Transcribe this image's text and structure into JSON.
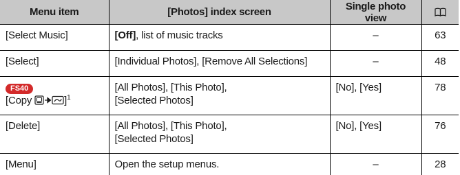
{
  "header": {
    "col_menu": "Menu item",
    "col_index": "[Photos] index screen",
    "col_single": "Single photo view",
    "col_page_icon": "book-icon"
  },
  "rows": [
    {
      "menu": "[Select Music]",
      "index_bold": "[Off]",
      "index_rest": ", list of music tracks",
      "single": "–",
      "page": "63"
    },
    {
      "menu": "[Select]",
      "index": "[Individual Photos], [Remove All Selections]",
      "single": "–",
      "page": "48"
    },
    {
      "badge": "FS40",
      "menu_prefix": "[Copy",
      "menu_icons": [
        "memory-icon",
        "arrow-right-icon",
        "card-icon"
      ],
      "menu_suffix": "]",
      "footnote": "1",
      "index_line1": "[All Photos], [This Photo],",
      "index_line2": "[Selected Photos]",
      "single": "[No], [Yes]",
      "page": "78"
    },
    {
      "menu": "[Delete]",
      "index_line1": "[All Photos], [This Photo],",
      "index_line2": "[Selected Photos]",
      "single": "[No], [Yes]",
      "page": "76"
    },
    {
      "menu": "[Menu]",
      "index": "Open the setup menus.",
      "single": "–",
      "page": "28"
    }
  ],
  "colors": {
    "header_bg": "#c8c8c8",
    "badge_bg": "#d32a2a",
    "rule": "#000000"
  }
}
